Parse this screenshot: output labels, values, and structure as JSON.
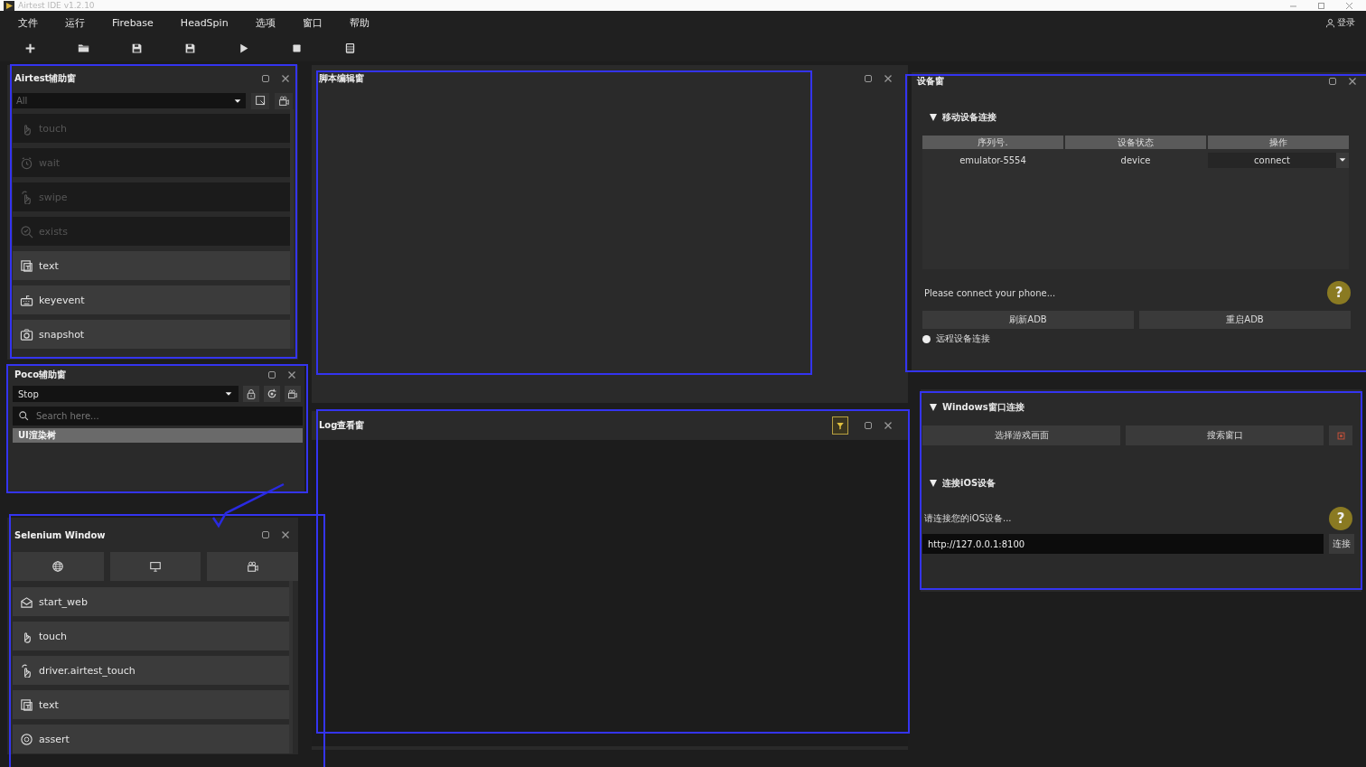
{
  "window": {
    "title": "Airtest IDE v1.2.10"
  },
  "menu": [
    {
      "label": "文件"
    },
    {
      "label": "运行"
    },
    {
      "label": "Firebase"
    },
    {
      "label": "HeadSpin"
    },
    {
      "label": "选项"
    },
    {
      "label": "窗口"
    },
    {
      "label": "帮助"
    }
  ],
  "account": {
    "label": "登录"
  },
  "airtest_panel": {
    "title": "Airtest辅助窗",
    "filter": "All",
    "items": [
      {
        "label": "touch",
        "kind": "touch",
        "disabled": true
      },
      {
        "label": "wait",
        "kind": "wait",
        "disabled": true
      },
      {
        "label": "swipe",
        "kind": "swipe",
        "disabled": true
      },
      {
        "label": "exists",
        "kind": "exists",
        "disabled": true
      },
      {
        "label": "text",
        "kind": "text",
        "disabled": false
      },
      {
        "label": "keyevent",
        "kind": "keyevent",
        "disabled": false
      },
      {
        "label": "snapshot",
        "kind": "snapshot",
        "disabled": false
      }
    ]
  },
  "poco_panel": {
    "title": "Poco辅助窗",
    "mode": "Stop",
    "search_placeholder": "Search here...",
    "tree": [
      {
        "label": "UI渲染树",
        "selected": true
      }
    ]
  },
  "selenium_panel": {
    "title": "Selenium Window",
    "items": [
      {
        "label": "start_web",
        "kind": "start_web"
      },
      {
        "label": "touch",
        "kind": "touch"
      },
      {
        "label": "driver.airtest_touch",
        "kind": "swipe"
      },
      {
        "label": "text",
        "kind": "text"
      },
      {
        "label": "assert",
        "kind": "assert"
      }
    ]
  },
  "script_panel": {
    "title": "脚本编辑窗"
  },
  "log_panel": {
    "title": "Log查看窗"
  },
  "device_panel": {
    "title": "设备窗",
    "mobile": {
      "title": "移动设备连接",
      "expanded": true,
      "columns": [
        "序列号.",
        "设备状态",
        "操作"
      ],
      "rows": [
        {
          "serial": "emulator-5554",
          "status": "device",
          "action": "connect"
        }
      ]
    },
    "status": "Please connect your phone...",
    "help": "?",
    "buttons": [
      "刷新ADB",
      "重启ADB"
    ],
    "remote": {
      "label": "远程设备连接",
      "checked": false
    }
  },
  "windows_section": {
    "title": "Windows窗口连接",
    "expanded": true,
    "buttons": [
      "选择游戏画面",
      "搜索窗口"
    ]
  },
  "ios_section": {
    "title": "连接iOS设备",
    "expanded": true,
    "hint": "请连接您的iOS设备...",
    "help": "?",
    "url": "http://127.0.0.1:8100",
    "connect": "连接"
  }
}
